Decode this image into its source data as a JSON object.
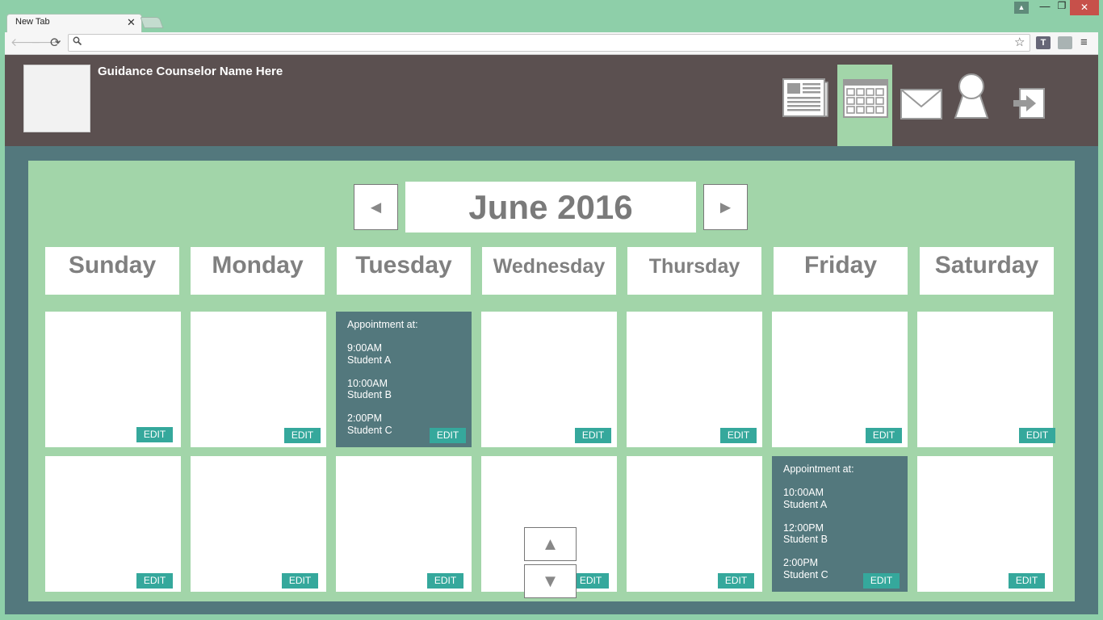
{
  "browser": {
    "tab_title": "New Tab",
    "tab_close": "✕",
    "back_icon": "🡐",
    "forward_icon": "🡒",
    "reload_icon": "⟳",
    "search_icon": "🔍",
    "star_icon": "☆",
    "ext_t_label": "T",
    "menu_icon": "≡",
    "win_user": "▲",
    "win_min": "—",
    "win_max": "❐",
    "win_close": "✕"
  },
  "header": {
    "counselor_name": "Guidance Counselor Name Here",
    "nav_icons": [
      "newspaper-icon",
      "calendar-icon",
      "mail-icon",
      "profile-icon",
      "logout-icon"
    ],
    "active_nav": "calendar-icon"
  },
  "calendar": {
    "month_label": "June 2016",
    "prev_icon": "◄",
    "next_icon": "►",
    "scroll_up_icon": "▲",
    "scroll_down_icon": "▼",
    "days": [
      "Sunday",
      "Monday",
      "Tuesday",
      "Wednesday",
      "Thursday",
      "Friday",
      "Saturday"
    ],
    "edit_label": "EDIT",
    "appointments": {
      "week1_tuesday": "Appointment at:\n\n9:00AM\nStudent A\n\n10:00AM\nStudent B\n\n2:00PM\nStudent C",
      "week2_friday": "Appointment at:\n\n10:00AM\nStudent A\n\n12:00PM\nStudent B\n\n2:00PM\nStudent C"
    }
  },
  "colors": {
    "chrome": "#8ecfa9",
    "header": "#5b5050",
    "frame": "#53787d",
    "panel": "#a2d5a9",
    "edit_button": "#35a89c",
    "appointment_cell": "#53787d"
  }
}
